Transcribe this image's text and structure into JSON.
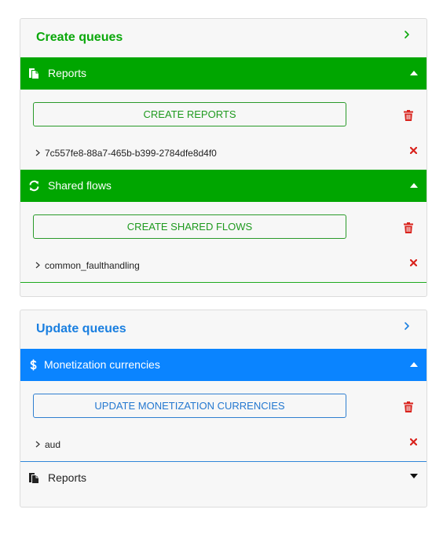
{
  "create_queues": {
    "title": "Create queues",
    "sections": [
      {
        "label": "Reports",
        "icon": "copy-icon",
        "button_label": "CREATE REPORTS",
        "items": [
          "7c557fe8-88a7-465b-b399-2784dfe8d4f0"
        ]
      },
      {
        "label": "Shared flows",
        "icon": "refresh-icon",
        "button_label": "CREATE SHARED FLOWS",
        "items": [
          "common_faulthandling"
        ]
      }
    ]
  },
  "update_queues": {
    "title": "Update queues",
    "sections": [
      {
        "label": "Monetization currencies",
        "icon": "dollar-icon",
        "button_label": "UPDATE MONETIZATION CURRENCIES",
        "items": [
          "aud"
        ]
      },
      {
        "label": "Reports",
        "icon": "copy-icon",
        "collapsed": true
      }
    ]
  },
  "colors": {
    "create_accent": "#00a600",
    "update_accent": "#0a84ff",
    "danger": "#d9231d"
  }
}
